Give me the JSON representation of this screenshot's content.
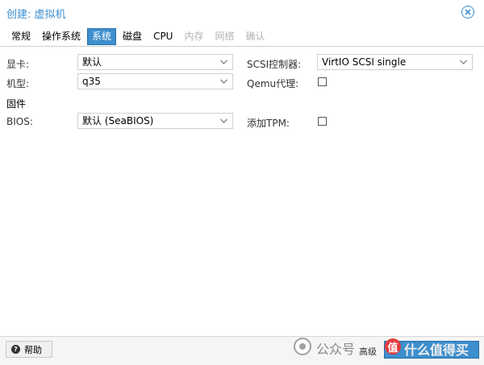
{
  "window": {
    "title": "创建: 虚拟机",
    "close_icon": "close-icon"
  },
  "tabs": [
    {
      "label": "常规",
      "state": "normal"
    },
    {
      "label": "操作系统",
      "state": "normal"
    },
    {
      "label": "系统",
      "state": "active"
    },
    {
      "label": "磁盘",
      "state": "normal"
    },
    {
      "label": "CPU",
      "state": "normal"
    },
    {
      "label": "内存",
      "state": "disabled"
    },
    {
      "label": "网络",
      "state": "disabled"
    },
    {
      "label": "确认",
      "state": "disabled"
    }
  ],
  "form": {
    "graphics_label": "显卡:",
    "graphics_value": "默认",
    "machine_label": "机型:",
    "machine_value": "q35",
    "firmware_section": "固件",
    "bios_label": "BIOS:",
    "bios_value": "默认 (SeaBIOS)",
    "scsi_label": "SCSI控制器:",
    "scsi_value": "VirtIO SCSI single",
    "qemu_agent_label": "Qemu代理:",
    "qemu_agent_checked": false,
    "tpm_label": "添加TPM:",
    "tpm_checked": false
  },
  "footer": {
    "help_label": "帮助",
    "help_icon": "question-icon",
    "advanced_label": "高级"
  },
  "watermark": {
    "left_text": "公众号",
    "right_text": "什么值得买"
  },
  "colors": {
    "accent": "#3d8fce",
    "disabled_text": "#b3b3b3",
    "border": "#cfcfcf"
  }
}
